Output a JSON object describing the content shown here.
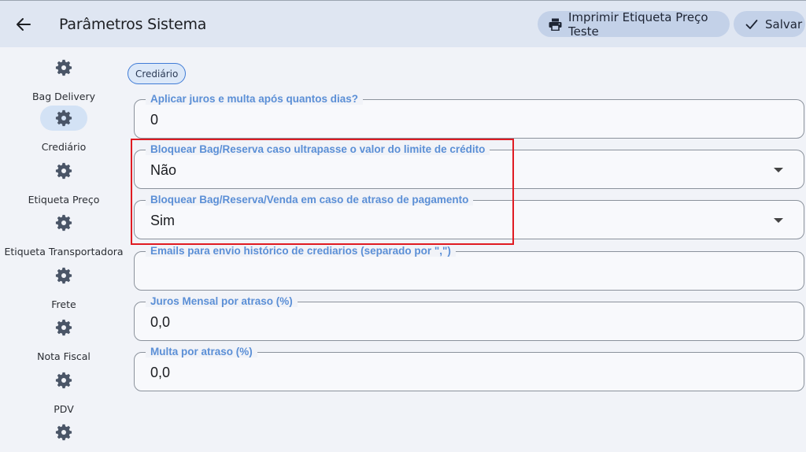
{
  "header": {
    "title": "Parâmetros Sistema",
    "back_icon": "arrow-left-icon",
    "print_button": {
      "label": "Imprimir Etiqueta Preço Teste",
      "icon": "printer-icon"
    },
    "save_button": {
      "label": "Salvar",
      "icon": "check-icon"
    }
  },
  "sidebar": {
    "items": [
      {
        "label": "Bag Delivery",
        "icon": "gear-icon",
        "active": false
      },
      {
        "label": "Crediário",
        "icon": "gear-icon",
        "active": true
      },
      {
        "label": "Etiqueta Preço",
        "icon": "gear-icon",
        "active": false
      },
      {
        "label": "Etiqueta Transportadora",
        "icon": "gear-icon",
        "active": false
      },
      {
        "label": "Frete",
        "icon": "gear-icon",
        "active": false
      },
      {
        "label": "Nota Fiscal",
        "icon": "gear-icon",
        "active": false
      },
      {
        "label": "PDV",
        "icon": "gear-icon",
        "active": false
      },
      {
        "label": "",
        "icon": "gear-icon",
        "active": false
      }
    ]
  },
  "section": {
    "chip": "Crediário"
  },
  "fields": [
    {
      "label": "Aplicar juros e multa após quantos dias?",
      "value": "0",
      "type": "text"
    },
    {
      "label": "Bloquear Bag/Reserva caso ultrapasse o valor do limite de crédito",
      "value": "Não",
      "type": "select"
    },
    {
      "label": "Bloquear Bag/Reserva/Venda em caso de atraso de pagamento",
      "value": "Sim",
      "type": "select"
    },
    {
      "label": "Emails para envio histórico de crediarios (separado por \",\")",
      "value": "",
      "type": "text"
    },
    {
      "label": "Juros Mensal por atraso (%)",
      "value": "0,0",
      "type": "text"
    },
    {
      "label": "Multa por atraso (%)",
      "value": "0,0",
      "type": "text"
    }
  ],
  "colors": {
    "accent": "#5b8fd6",
    "header_bg": "#dfe6f2",
    "button_bg": "#c3d1e8",
    "highlight": "#e01b22"
  }
}
